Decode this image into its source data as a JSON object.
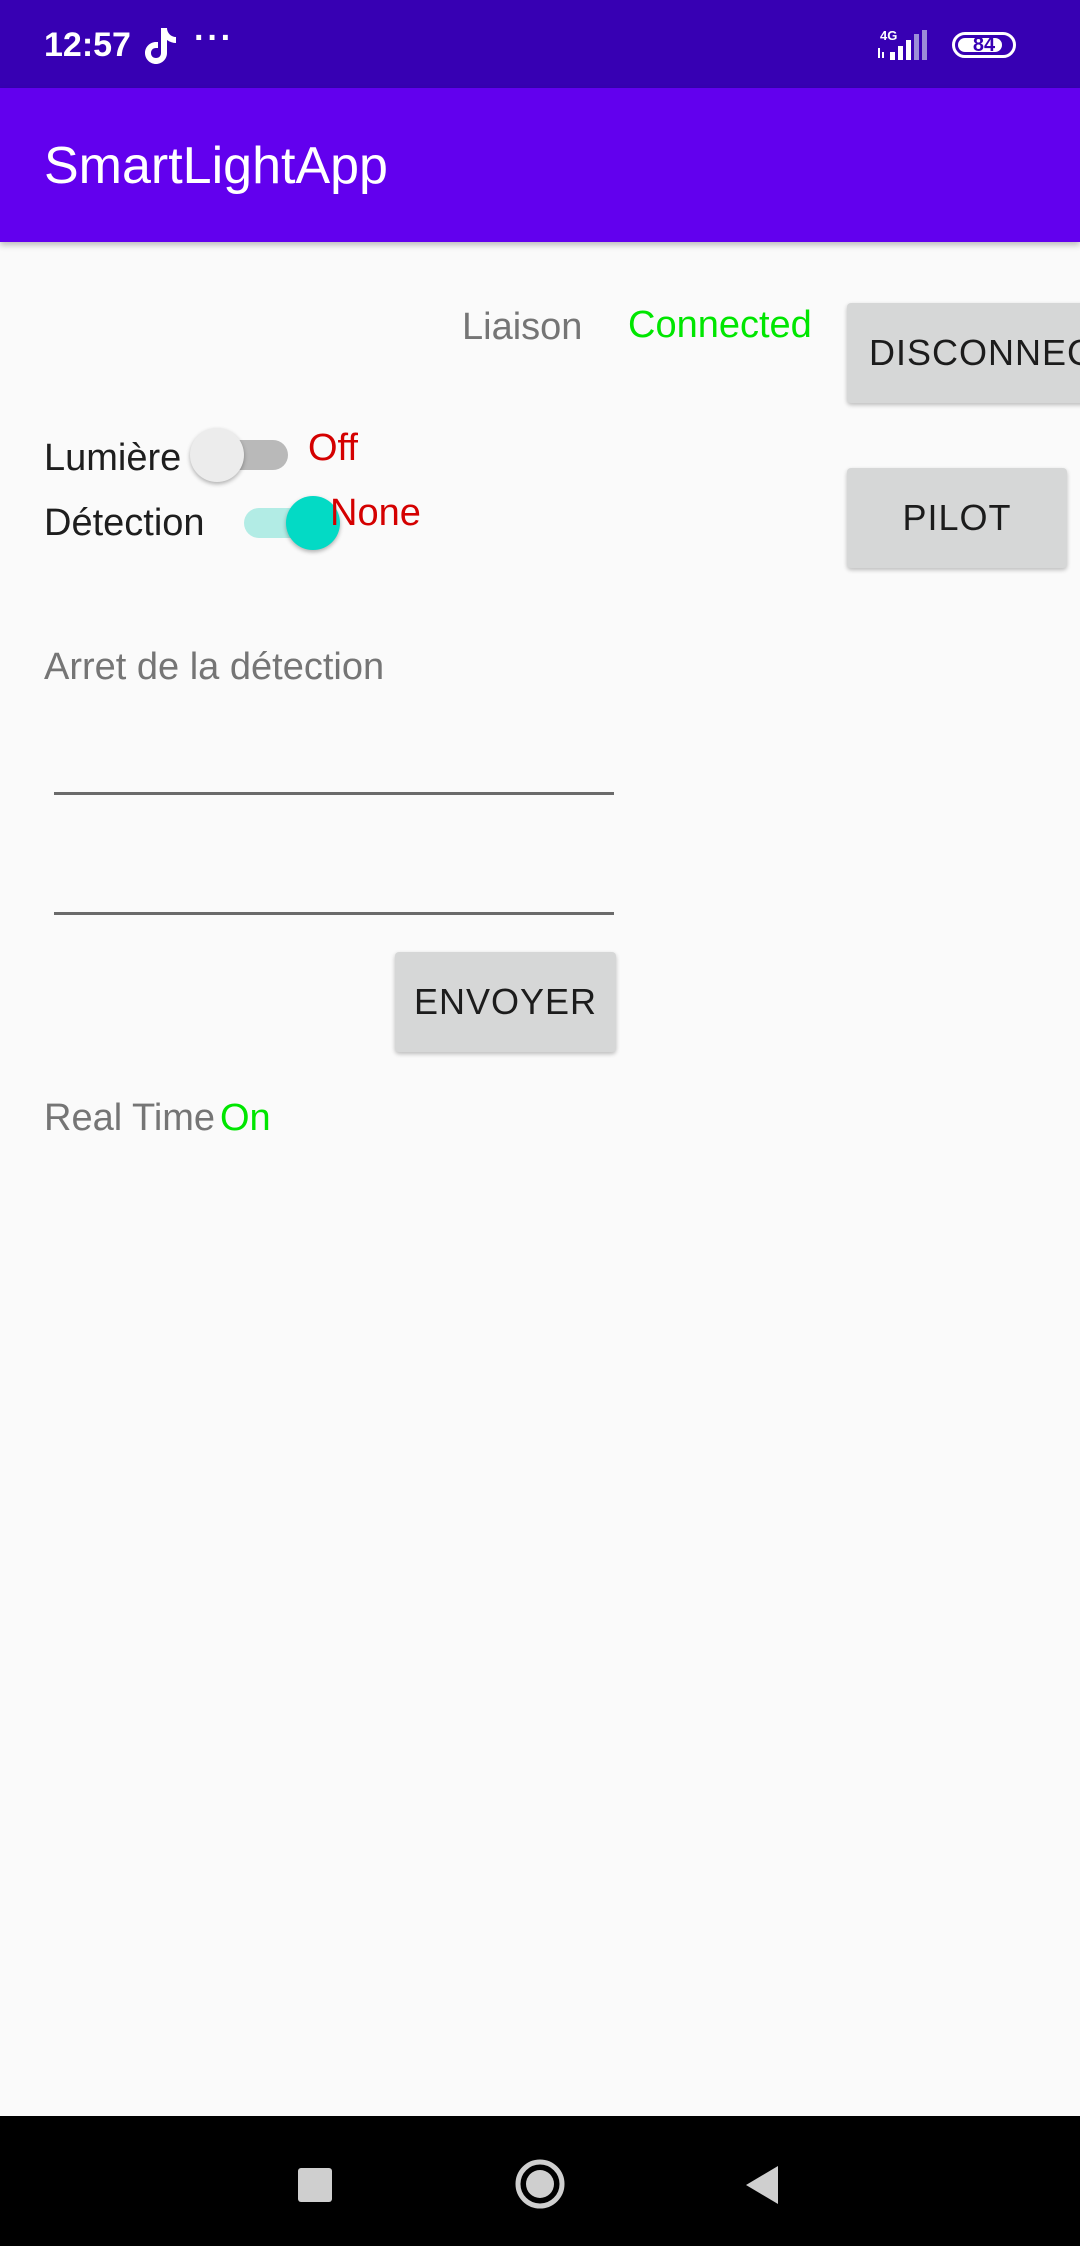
{
  "status_bar": {
    "time": "12:57",
    "more": "···",
    "network": "4G",
    "battery_level": "84",
    "battery_fraction": 0.84,
    "icons": [
      "tiktok-icon",
      "signal-icon",
      "battery-icon"
    ]
  },
  "app_bar": {
    "title": "SmartLightApp"
  },
  "connection": {
    "label": "Liaison",
    "status": "Connected",
    "disconnect_button": "DISCONNECT"
  },
  "lumiere": {
    "label": "Lumière",
    "state": "Off",
    "switch_on": false
  },
  "detection": {
    "label": "Détection",
    "state": "None",
    "switch_on": true
  },
  "pilot_button": "PILOT",
  "stop_detection": {
    "label": "Arret de la détection",
    "field_1_value": "",
    "field_2_value": "",
    "send_button": "ENVOYER"
  },
  "real_time": {
    "label": "Real Time",
    "state": "On"
  },
  "colors": {
    "status_bar": "#3700b3",
    "app_bar": "#6200ee",
    "connected": "#00e600",
    "state_red": "#d40000",
    "switch_accent": "#03dac5"
  },
  "nav_bar": {
    "icons": [
      "recents-icon",
      "home-icon",
      "back-icon"
    ]
  }
}
